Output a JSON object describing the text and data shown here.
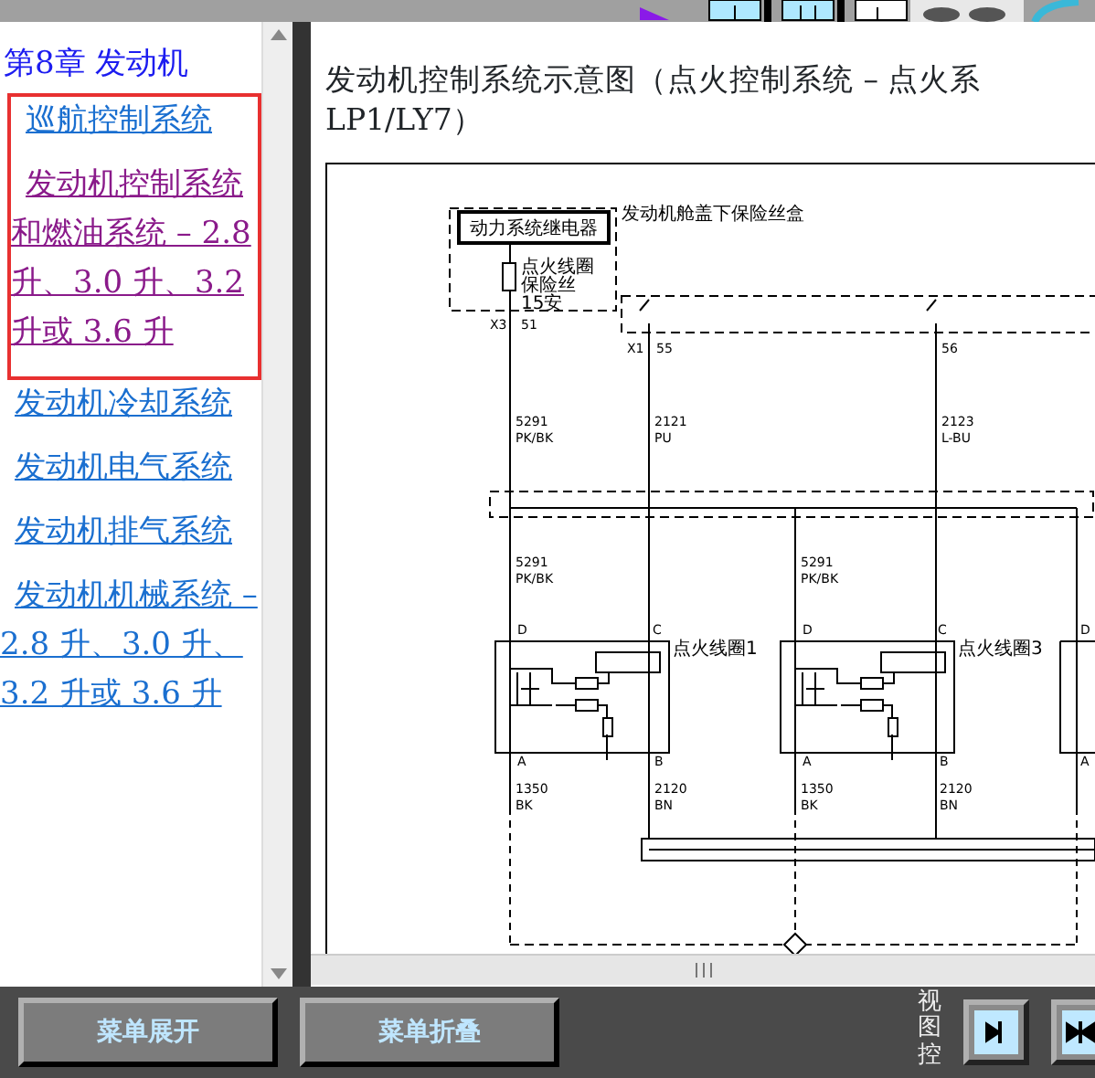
{
  "sidebar": {
    "chapter": "第8章 发动机",
    "items": [
      {
        "label": "巡航控制系统",
        "selected": false,
        "boxed": true
      },
      {
        "label": "发动机控制系统和燃油系统 – 2.8 升、3.0 升、3.2 升或 3.6 升",
        "selected": true,
        "boxed": true
      },
      {
        "label": "发动机冷却系统",
        "selected": false,
        "boxed": false
      },
      {
        "label": "发动机电气系统",
        "selected": false,
        "boxed": false
      },
      {
        "label": "发动机排气系统",
        "selected": false,
        "boxed": false
      },
      {
        "label": "发动机机械系统 – 2.8 升、3.0 升、3.2 升或 3.6 升",
        "selected": false,
        "boxed": false
      }
    ]
  },
  "content": {
    "title_lines": [
      "发动机控制系统示意图（点火控制系统 – 点火系",
      "LP1/LY7）"
    ],
    "diagram": {
      "labels": [
        "动力系统继电器",
        "发动机舱盖下保险丝盒",
        "点火线圈",
        "保险丝",
        "15安",
        "X3",
        "51",
        "X1",
        "55",
        "56",
        "5291",
        "PK/BK",
        "2121",
        "PU",
        "2123",
        "L-BU",
        "5291",
        "PK/BK",
        "5291",
        "PK/BK",
        "D",
        "C",
        "点火线圈1",
        "A",
        "B",
        "1350",
        "BK",
        "2120",
        "BN",
        "D",
        "C",
        "点火线圈3",
        "A",
        "B",
        "1350",
        "BK",
        "2120",
        "BN",
        "D",
        "A"
      ]
    }
  },
  "footer": {
    "buttons": [
      "菜单展开",
      "菜单折叠"
    ],
    "view_label": "视图控"
  }
}
